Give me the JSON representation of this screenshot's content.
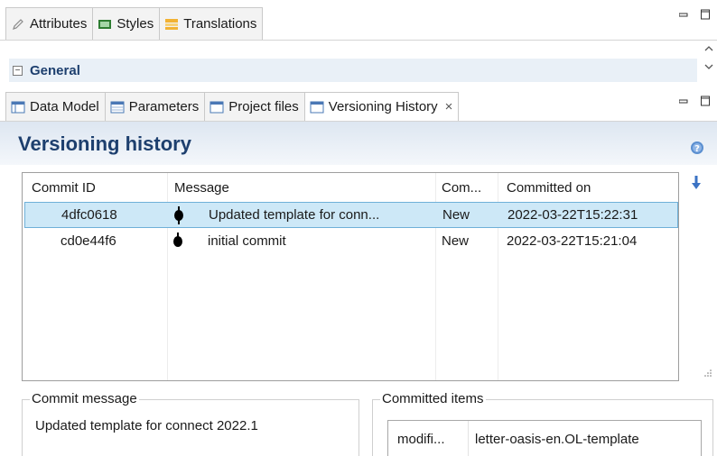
{
  "top_view": {
    "tabs": [
      {
        "label": "Attributes",
        "icon": "pencil-icon"
      },
      {
        "label": "Styles",
        "icon": "css-icon"
      },
      {
        "label": "Translations",
        "icon": "translations-icon"
      }
    ],
    "section_label": "General",
    "section_toggle": "−"
  },
  "bottom_view": {
    "tabs": [
      {
        "label": "Data Model",
        "icon": "data-model-icon"
      },
      {
        "label": "Parameters",
        "icon": "parameters-icon"
      },
      {
        "label": "Project files",
        "icon": "project-files-icon"
      },
      {
        "label": "Versioning History",
        "icon": "versioning-icon",
        "active": true
      }
    ],
    "close_glyph": "×"
  },
  "window_controls": {
    "minimize": "▭",
    "maximize": "◻"
  },
  "versioning": {
    "title": "Versioning history",
    "columns": [
      "Commit ID",
      "Message",
      "Com...",
      "Committed on"
    ],
    "rows": [
      {
        "commit_id": "4dfc0618",
        "message": "Updated template for conn...",
        "status": "New",
        "committed_on": "2022-03-22T15:22:31",
        "selected": true
      },
      {
        "commit_id": "cd0e44f6",
        "message": "initial commit",
        "status": "New",
        "committed_on": "2022-03-22T15:21:04",
        "selected": false
      }
    ],
    "commit_message_label": "Commit message",
    "commit_message_text": "Updated template for connect 2022.1",
    "committed_items_label": "Committed items",
    "committed_items": [
      {
        "change": "modifi...",
        "file": "letter-oasis-en.OL-template"
      }
    ]
  },
  "colors": {
    "accent_title": "#1d3f6e",
    "selection_bg": "#cde8f7",
    "selection_border": "#6fb0d8",
    "header_band_top": "#dde6f1"
  }
}
